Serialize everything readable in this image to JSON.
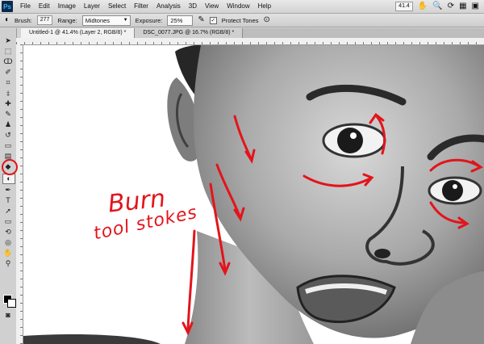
{
  "menubar": {
    "logo": "Ps",
    "items": [
      "File",
      "Edit",
      "Image",
      "Layer",
      "Select",
      "Filter",
      "Analysis",
      "3D",
      "View",
      "Window",
      "Help"
    ],
    "zoom": "41.4"
  },
  "options": {
    "brush_label": "Brush:",
    "brush_size": "277",
    "range_label": "Range:",
    "range_value": "Midtones",
    "exposure_label": "Exposure:",
    "exposure_value": "25%",
    "protect_label": "Protect Tones",
    "protect_checked": true
  },
  "tabs": [
    {
      "label": "Untitled-1 @ 41.4% (Layer 2, RGB/8) *",
      "active": true
    },
    {
      "label": "DSC_0077.JPG @ 16.7% (RGB/8) *",
      "active": false
    }
  ],
  "annotation": {
    "line1": "Burn",
    "line2": "tool stokes",
    "color": "#e3141b"
  },
  "colors": {
    "accent_red": "#e3141b",
    "foreground": "#000000",
    "background": "#ffffff"
  }
}
